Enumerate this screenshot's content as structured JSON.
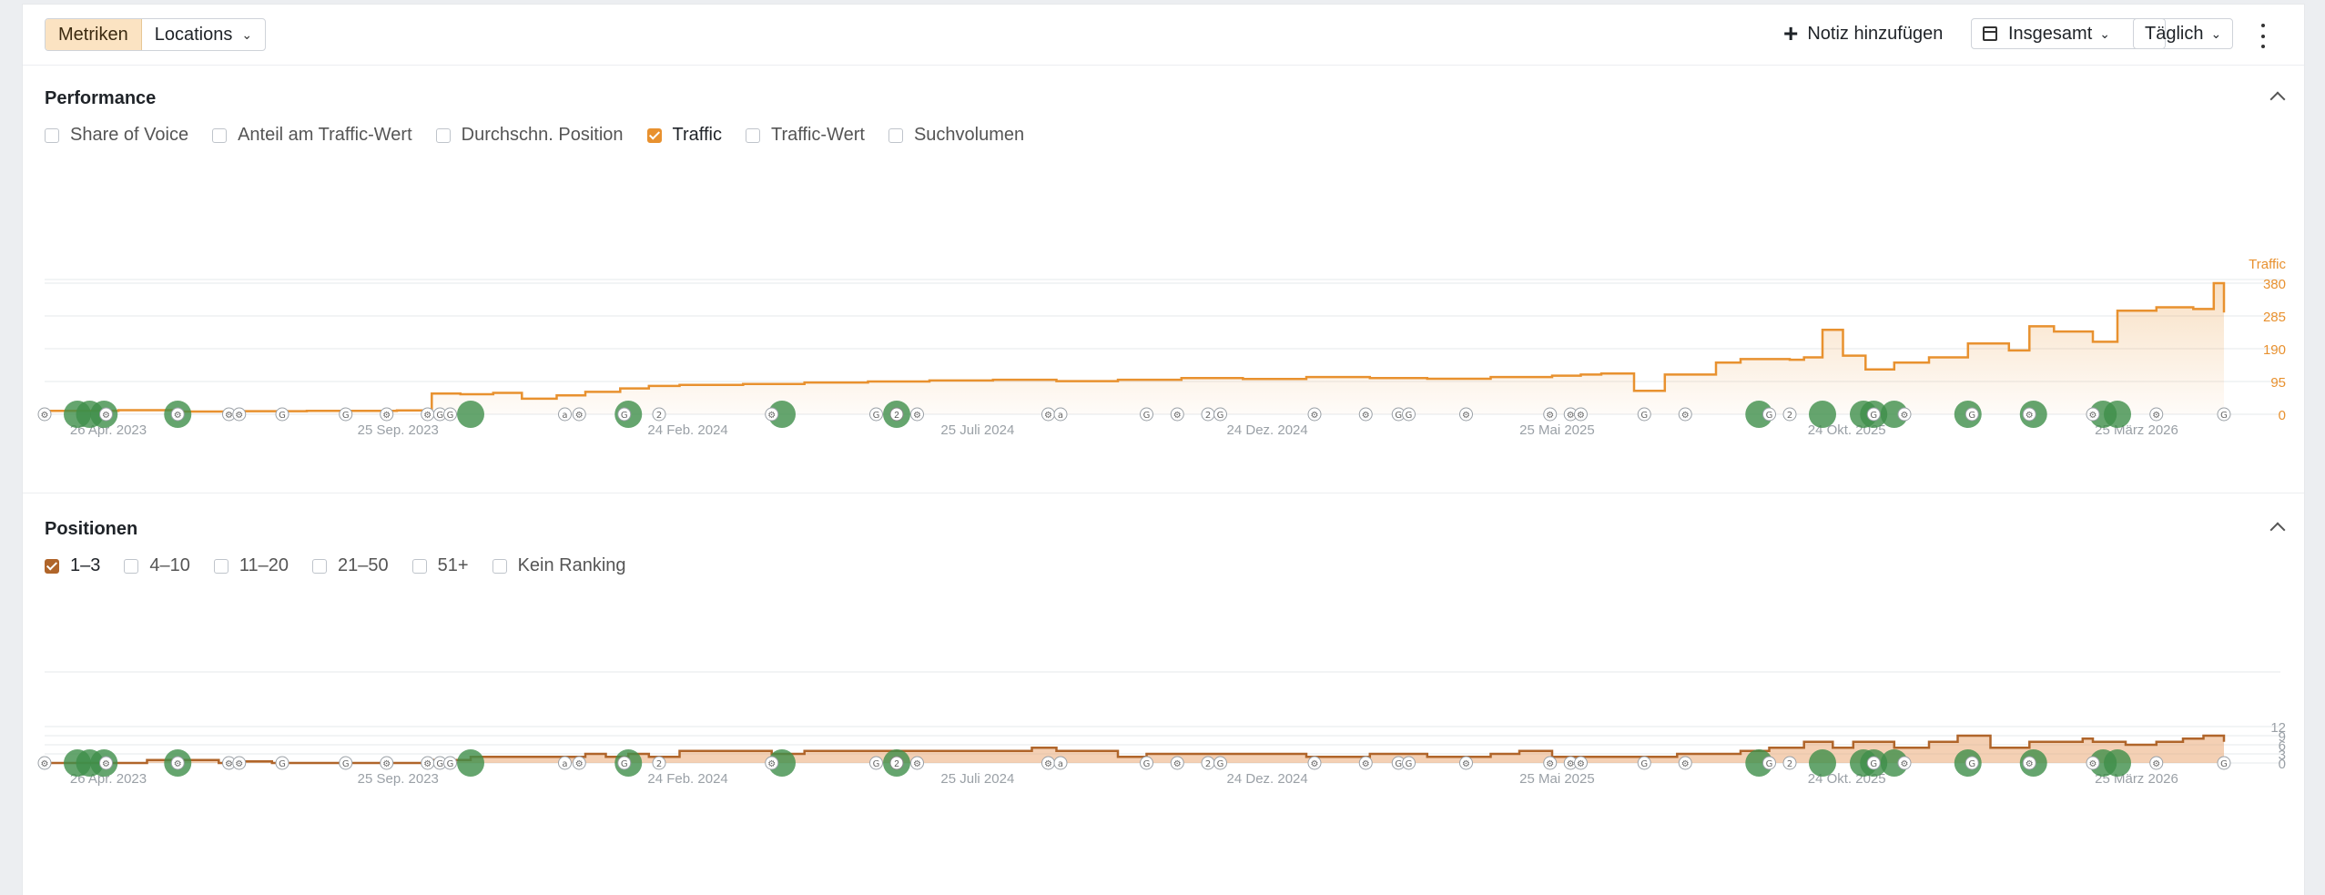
{
  "toolbar": {
    "view_modes": [
      "Metriken",
      "Locations"
    ],
    "add_note_label": "Notiz hinzufügen",
    "range_label": "Insgesamt",
    "interval_label": "Täglich"
  },
  "performance": {
    "title": "Performance",
    "metrics": [
      {
        "label": "Share of Voice",
        "checked": false
      },
      {
        "label": "Anteil am Traffic-Wert",
        "checked": false
      },
      {
        "label": "Durchschn. Position",
        "checked": false
      },
      {
        "label": "Traffic",
        "checked": true
      },
      {
        "label": "Traffic-Wert",
        "checked": false
      },
      {
        "label": "Suchvolumen",
        "checked": false
      }
    ]
  },
  "positions": {
    "title": "Positionen",
    "buckets": [
      {
        "label": "1–3",
        "checked": true
      },
      {
        "label": "4–10",
        "checked": false
      },
      {
        "label": "11–20",
        "checked": false
      },
      {
        "label": "21–50",
        "checked": false
      },
      {
        "label": "51+",
        "checked": false
      },
      {
        "label": "Kein Ranking",
        "checked": false
      }
    ]
  },
  "colors": {
    "traffic": "#e8912f",
    "positions": "#b0652a",
    "update_marker": "#3e8e4a"
  },
  "events": {
    "small_icons": [
      {
        "date": "2023-04-26",
        "g": "⚙"
      },
      {
        "date": "2023-05-26",
        "g": "⚙"
      },
      {
        "date": "2023-06-30",
        "g": "⚙"
      },
      {
        "date": "2023-07-25",
        "g": "⚙"
      },
      {
        "date": "2023-07-30",
        "g": "⚙"
      },
      {
        "date": "2023-08-20",
        "g": "G"
      },
      {
        "date": "2023-09-20",
        "g": "G"
      },
      {
        "date": "2023-10-10",
        "g": "⚙"
      },
      {
        "date": "2023-10-30",
        "g": "⚙"
      },
      {
        "date": "2023-11-05",
        "g": "G"
      },
      {
        "date": "2023-11-10",
        "g": "G"
      },
      {
        "date": "2024-01-05",
        "g": "a"
      },
      {
        "date": "2024-01-12",
        "g": "⚙"
      },
      {
        "date": "2024-02-03",
        "g": "G"
      },
      {
        "date": "2024-02-20",
        "g": "2"
      },
      {
        "date": "2024-04-15",
        "g": "⚙"
      },
      {
        "date": "2024-06-05",
        "g": "G"
      },
      {
        "date": "2024-06-25",
        "g": "⚙"
      },
      {
        "date": "2024-08-28",
        "g": "⚙"
      },
      {
        "date": "2024-09-03",
        "g": "a"
      },
      {
        "date": "2024-10-15",
        "g": "G"
      },
      {
        "date": "2024-10-30",
        "g": "⚙"
      },
      {
        "date": "2024-11-14",
        "g": "2"
      },
      {
        "date": "2024-11-20",
        "g": "G"
      },
      {
        "date": "2025-01-05",
        "g": "⚙"
      },
      {
        "date": "2025-01-30",
        "g": "⚙"
      },
      {
        "date": "2025-02-15",
        "g": "G"
      },
      {
        "date": "2025-02-20",
        "g": "G"
      },
      {
        "date": "2025-03-20",
        "g": "⚙"
      },
      {
        "date": "2025-04-30",
        "g": "⚙"
      },
      {
        "date": "2025-05-10",
        "g": "⚙"
      },
      {
        "date": "2025-05-15",
        "g": "⚙"
      },
      {
        "date": "2025-06-15",
        "g": "G"
      },
      {
        "date": "2025-07-05",
        "g": "⚙"
      },
      {
        "date": "2025-08-15",
        "g": "G"
      },
      {
        "date": "2025-08-25",
        "g": "2"
      },
      {
        "date": "2025-10-05",
        "g": "G"
      },
      {
        "date": "2025-10-20",
        "g": "⚙"
      },
      {
        "date": "2025-11-22",
        "g": "G"
      },
      {
        "date": "2025-12-20",
        "g": "⚙"
      },
      {
        "date": "2026-01-20",
        "g": "⚙"
      },
      {
        "date": "2026-02-20",
        "g": "⚙"
      },
      {
        "date": "2026-03-25",
        "g": "G"
      }
    ],
    "updates": [
      {
        "date": "2023-05-12"
      },
      {
        "date": "2023-05-18"
      },
      {
        "date": "2023-05-25"
      },
      {
        "date": "2023-06-30"
      },
      {
        "date": "2023-11-20"
      },
      {
        "date": "2024-02-05"
      },
      {
        "date": "2024-04-20"
      },
      {
        "date": "2024-06-15",
        "g": "2"
      },
      {
        "date": "2025-08-10"
      },
      {
        "date": "2025-09-10"
      },
      {
        "date": "2025-09-30"
      },
      {
        "date": "2025-10-05"
      },
      {
        "date": "2025-10-15"
      },
      {
        "date": "2025-11-20"
      },
      {
        "date": "2025-12-22"
      },
      {
        "date": "2026-01-25"
      },
      {
        "date": "2026-02-01"
      }
    ]
  },
  "chart_data": [
    {
      "type": "area",
      "series": [
        {
          "name": "Traffic",
          "x": [
            "2023-04-26",
            "2023-06-01",
            "2023-07-01",
            "2023-08-01",
            "2023-09-01",
            "2023-10-15",
            "2023-11-01",
            "2023-11-15",
            "2023-12-01",
            "2023-12-15",
            "2024-01-01",
            "2024-01-15",
            "2024-02-01",
            "2024-02-15",
            "2024-03-01",
            "2024-04-01",
            "2024-05-01",
            "2024-06-01",
            "2024-07-01",
            "2024-08-01",
            "2024-09-01",
            "2024-10-01",
            "2024-11-01",
            "2024-12-01",
            "2025-01-01",
            "2025-02-01",
            "2025-03-01",
            "2025-04-01",
            "2025-05-01",
            "2025-05-15",
            "2025-05-25",
            "2025-06-10",
            "2025-06-25",
            "2025-07-01",
            "2025-07-20",
            "2025-08-01",
            "2025-08-25",
            "2025-09-01",
            "2025-09-10",
            "2025-09-20",
            "2025-10-01",
            "2025-10-15",
            "2025-11-01",
            "2025-11-20",
            "2025-12-10",
            "2025-12-20",
            "2026-01-01",
            "2026-01-20",
            "2026-02-01",
            "2026-02-20",
            "2026-03-10",
            "2026-03-20",
            "2026-03-25"
          ],
          "values": [
            10,
            12,
            8,
            9,
            10,
            11,
            60,
            58,
            62,
            45,
            55,
            65,
            75,
            82,
            85,
            88,
            92,
            95,
            98,
            100,
            96,
            100,
            105,
            102,
            108,
            105,
            103,
            108,
            112,
            115,
            118,
            68,
            115,
            115,
            150,
            160,
            158,
            165,
            245,
            170,
            130,
            150,
            165,
            205,
            185,
            255,
            240,
            210,
            300,
            310,
            305,
            380,
            295
          ]
        }
      ],
      "xlabel": "",
      "ylabel": "Traffic",
      "x_ticks": [
        "26 Apr. 2023",
        "25 Sep. 2023",
        "24 Feb. 2024",
        "25 Juli 2024",
        "24 Dez. 2024",
        "25 Mai 2025",
        "24 Okt. 2025",
        "25 März 2026"
      ],
      "xlim": [
        "2023-04-26",
        "2026-03-25"
      ],
      "y_ticks": [
        "0",
        "95",
        "190",
        "285",
        "380"
      ],
      "ylim": [
        0,
        380
      ],
      "grid": true
    },
    {
      "type": "area",
      "series": [
        {
          "name": "1–3",
          "x": [
            "2023-04-26",
            "2023-06-15",
            "2023-07-20",
            "2023-08-01",
            "2023-08-15",
            "2023-09-01",
            "2023-09-20",
            "2023-10-20",
            "2023-11-01",
            "2023-11-20",
            "2023-12-01",
            "2023-12-20",
            "2024-01-15",
            "2024-01-25",
            "2024-02-05",
            "2024-02-15",
            "2024-03-01",
            "2024-04-01",
            "2024-04-15",
            "2024-05-01",
            "2024-06-01",
            "2024-07-01",
            "2024-08-01",
            "2024-08-20",
            "2024-09-01",
            "2024-10-01",
            "2024-10-15",
            "2024-11-01",
            "2024-12-01",
            "2025-01-01",
            "2025-02-01",
            "2025-03-01",
            "2025-04-01",
            "2025-04-15",
            "2025-05-01",
            "2025-06-01",
            "2025-07-01",
            "2025-07-20",
            "2025-08-01",
            "2025-08-15",
            "2025-09-01",
            "2025-09-15",
            "2025-09-25",
            "2025-10-05",
            "2025-10-15",
            "2025-11-01",
            "2025-11-15",
            "2025-12-01",
            "2025-12-20",
            "2026-01-01",
            "2026-01-15",
            "2026-01-20",
            "2026-02-05",
            "2026-02-20",
            "2026-03-05",
            "2026-03-15",
            "2026-03-25"
          ],
          "values": [
            0,
            1,
            0,
            0.5,
            0,
            0,
            0,
            0,
            1,
            2,
            2,
            2,
            3,
            2,
            3,
            2,
            4,
            4,
            3,
            4,
            4,
            4,
            4,
            5,
            4,
            2,
            3,
            3,
            3,
            2,
            3,
            2,
            3,
            4,
            2,
            2,
            3,
            3,
            4,
            5,
            7,
            5,
            7,
            7,
            5,
            7,
            9,
            5,
            7,
            7,
            8,
            7,
            6,
            7,
            8,
            9,
            7
          ]
        }
      ],
      "x_ticks": [
        "26 Apr. 2023",
        "25 Sep. 2023",
        "24 Feb. 2024",
        "25 Juli 2024",
        "24 Dez. 2024",
        "25 Mai 2025",
        "24 Okt. 2025",
        "25 März 2026"
      ],
      "xlim": [
        "2023-04-26",
        "2026-03-25"
      ],
      "y_ticks": [
        "0",
        "3",
        "6",
        "9",
        "12"
      ],
      "ylim": [
        0,
        12
      ],
      "grid": true
    }
  ]
}
